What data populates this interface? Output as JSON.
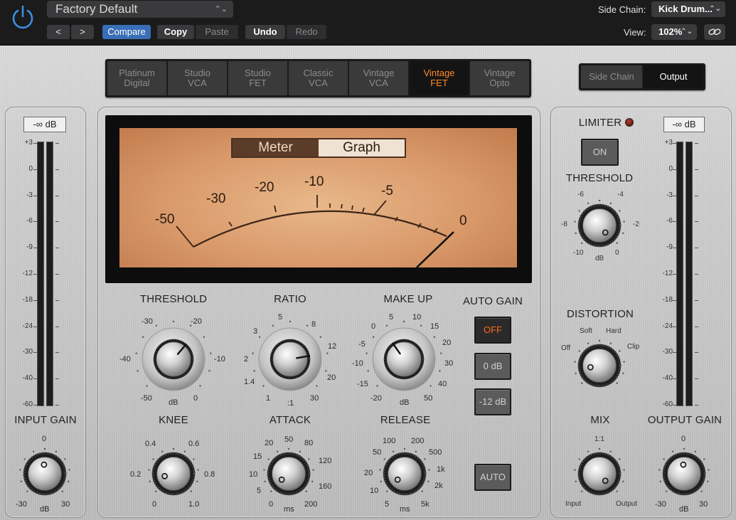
{
  "toolbar": {
    "preset": "Factory Default",
    "back_label": "<",
    "forward_label": ">",
    "compare_label": "Compare",
    "copy_label": "Copy",
    "paste_label": "Paste",
    "undo_label": "Undo",
    "redo_label": "Redo",
    "side_chain_label": "Side Chain:",
    "side_chain_value": "Kick Drum...",
    "view_label": "View:",
    "view_value": "102%"
  },
  "circuit_types": [
    "Platinum\nDigital",
    "Studio\nVCA",
    "Studio\nFET",
    "Classic\nVCA",
    "Vintage\nVCA",
    "Vintage\nFET",
    "Vintage\nOpto"
  ],
  "circuit_selected": 5,
  "meter_source": {
    "side_chain": "Side Chain",
    "output": "Output",
    "selected": "Output"
  },
  "input": {
    "readout": "-∞ dB",
    "scale": [
      "+3",
      "0",
      "-3",
      "-6",
      "-9",
      "-12",
      "-18",
      "-24",
      "-30",
      "-40",
      "-60"
    ],
    "gain_label": "INPUT GAIN",
    "gain_ticks": {
      "top": "0",
      "left": "-30",
      "unit": "dB",
      "right": "30"
    }
  },
  "vu": {
    "meter_label": "Meter",
    "graph_label": "Graph",
    "scale": [
      "-50",
      "-30",
      "-20",
      "-10",
      "-5",
      "0"
    ]
  },
  "knobs": {
    "threshold": {
      "label": "THRESHOLD",
      "ticks": [
        "-30",
        "-20",
        "-40",
        "-10",
        "-50",
        "dB",
        "0"
      ]
    },
    "ratio": {
      "label": "RATIO",
      "ticks": [
        "5",
        "3",
        "8",
        "2",
        "12",
        "1.4",
        "20",
        "1",
        ":1",
        "30"
      ]
    },
    "makeup": {
      "label": "MAKE UP",
      "ticks": [
        "5",
        "10",
        "0",
        "15",
        "-5",
        "20",
        "-10",
        "30",
        "-15",
        "40",
        "-20",
        "dB",
        "50"
      ]
    },
    "knee": {
      "label": "KNEE",
      "ticks": [
        "0.4",
        "0.6",
        "0.2",
        "0.8",
        "0",
        "1.0"
      ]
    },
    "attack": {
      "label": "ATTACK",
      "ticks": [
        "20",
        "50",
        "80",
        "15",
        "120",
        "10",
        "160",
        "5",
        "0",
        "ms",
        "200"
      ]
    },
    "release": {
      "label": "RELEASE",
      "ticks": [
        "100",
        "200",
        "50",
        "500",
        "20",
        "1k",
        "10",
        "2k",
        "5",
        "ms",
        "5k"
      ]
    }
  },
  "auto_gain": {
    "label": "AUTO GAIN",
    "off": "OFF",
    "zero": "0 dB",
    "minus12": "-12 dB",
    "auto": "AUTO"
  },
  "limiter": {
    "label": "LIMITER",
    "on": "ON",
    "threshold_label": "THRESHOLD",
    "threshold_ticks": [
      "-6",
      "-4",
      "-8",
      "-2",
      "-10",
      "dB",
      "0"
    ]
  },
  "distortion": {
    "label": "DISTORTION",
    "ticks": [
      "Soft",
      "Hard",
      "Off",
      "Clip"
    ]
  },
  "mix": {
    "label": "MIX",
    "ticks": [
      "1:1",
      "Input",
      "Output"
    ]
  },
  "output": {
    "readout": "-∞ dB",
    "scale": [
      "+3",
      "0",
      "-3",
      "-6",
      "-9",
      "-12",
      "-18",
      "-24",
      "-30",
      "-40",
      "-60"
    ],
    "gain_label": "OUTPUT GAIN",
    "gain_ticks": {
      "top": "0",
      "left": "-30",
      "unit": "dB",
      "right": "30"
    }
  }
}
